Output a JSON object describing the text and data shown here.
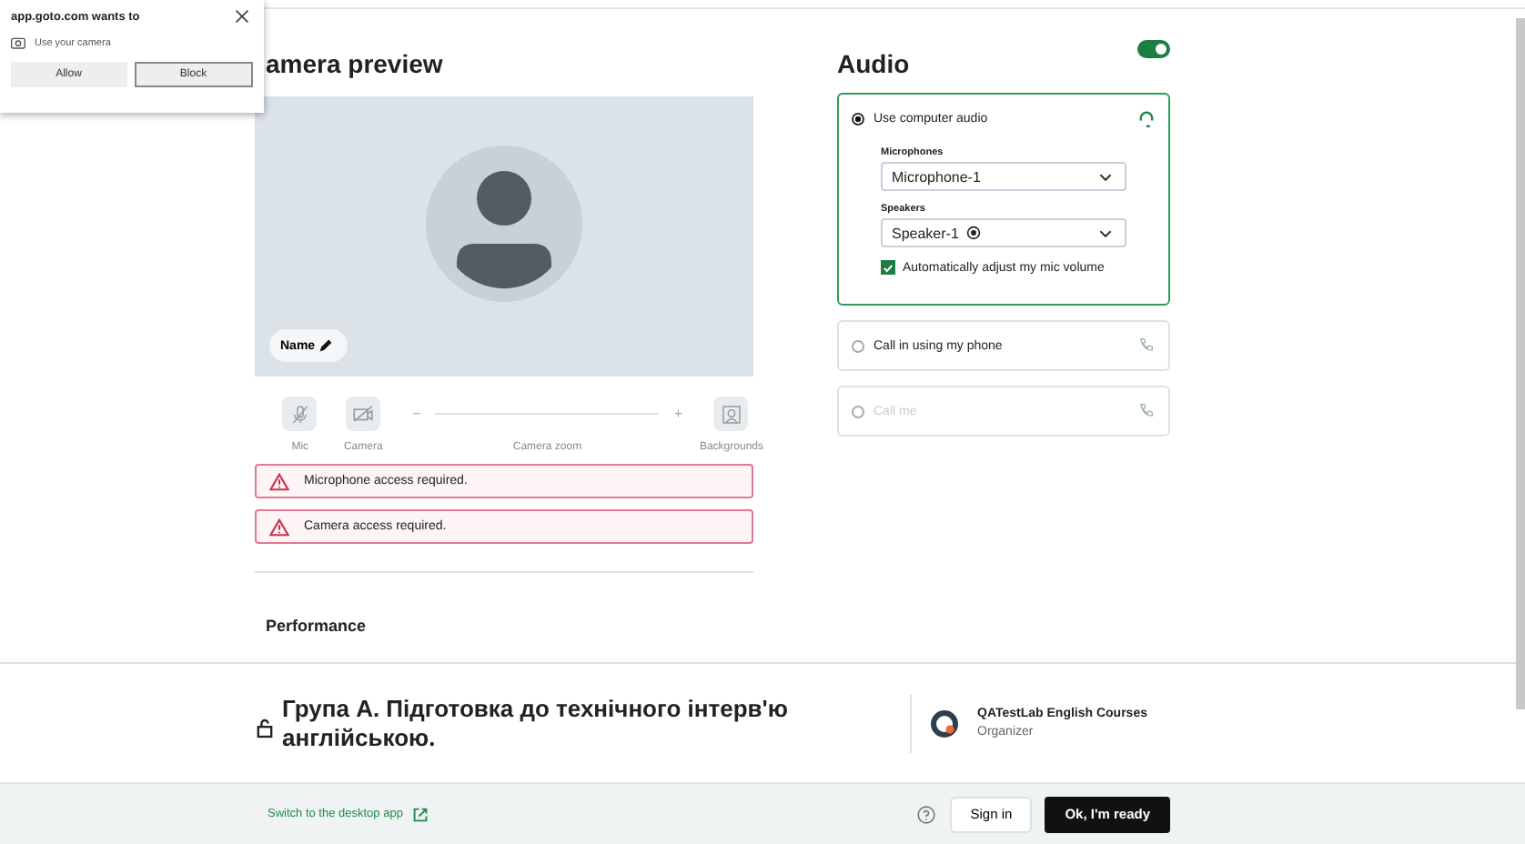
{
  "permission_prompt": {
    "origin": "app.goto.com wants to",
    "permission": "Use your camera",
    "buttons": [
      {
        "label": "Allow",
        "selected": false
      },
      {
        "label": "Block",
        "selected": true
      }
    ]
  },
  "camera_preview": {
    "title": "amera preview",
    "name_label": "Name",
    "controls": [
      {
        "kind": "mic",
        "label": "Mic"
      },
      {
        "kind": "camera",
        "label": "Camera"
      },
      {
        "kind": "zoom",
        "label": "Camera zoom",
        "level": 0,
        "minus": "−",
        "plus": "+"
      },
      {
        "kind": "backgrounds",
        "label": "Backgrounds"
      }
    ]
  },
  "alerts": [
    "Microphone access required.",
    "Camera access required."
  ],
  "performance": {
    "title": "Performance"
  },
  "audio": {
    "title": "Audio",
    "on": true,
    "options": [
      {
        "kind": "computer",
        "label": "Use computer audio",
        "selected": true,
        "disabled": false,
        "microphones_label": "Microphones",
        "microphone": "Microphone-1",
        "speakers_label": "Speakers",
        "speaker": "Speaker-1",
        "auto_adjust": {
          "label": "Automatically adjust my mic volume",
          "checked": true
        }
      },
      {
        "kind": "phone",
        "label": "Call in using my phone",
        "selected": false,
        "disabled": false
      },
      {
        "kind": "callme",
        "label": "Call me",
        "selected": false,
        "disabled": true
      }
    ]
  },
  "meeting": {
    "title": "Група А. Підготовка до технічного інтерв'ю англійською.",
    "organizer": "QATestLab English Courses",
    "role": "Organizer"
  },
  "footer": {
    "desktop_link": "Switch to the desktop app",
    "sign_in": "Sign in",
    "ready": "Ok, I'm ready"
  }
}
